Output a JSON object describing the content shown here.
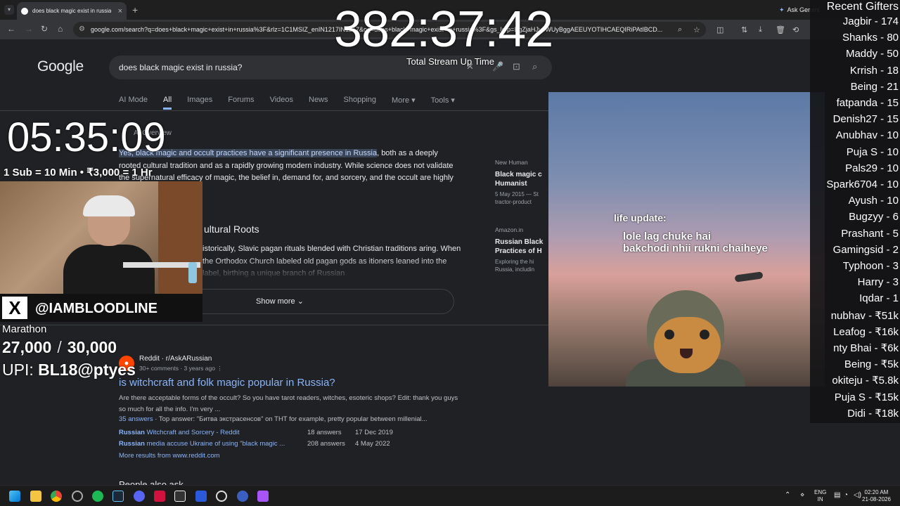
{
  "browser": {
    "tab_title": "does black magic exist in russia",
    "url": "google.com/search?q=does+black+magic+exist+in+russia%3F&rlz=1C1MSIZ_enIN1217IN1217&oq=does+black+magic+exist+in+russia%3F&gs_lcrp=EgZjaHJvbWUyBggAEEUYOTIHCAEQIRiPAtIBCD...",
    "ask_gemini": "Ask Gemini"
  },
  "google": {
    "logo": "Google",
    "query": "does black magic exist in russia?",
    "tabs": [
      "AI Mode",
      "All",
      "Images",
      "Forums",
      "Videos",
      "News",
      "Shopping",
      "More",
      "Tools"
    ],
    "ai_overview_label": "AI Overview",
    "ai_text_highlight": "Yes, black magic and occult practices have a significant presence in Russia",
    "ai_text_rest": ", both as a deeply rooted cultural tradition and as a rapidly growing modern industry. While science does not validate the supernatural efficacy of magic, the belief in, demand for, and sorcery, and the occult are highly prevalent across the",
    "section_heading": "ultural Roots",
    "history_text": "istorically, Slavic pagan rituals blended with Christian traditions aring. When the Orthodox Church labeled old pagan gods as itioners leaned into the label, birthing a unique branch of Russian",
    "show_more": "Show more",
    "source_cards": [
      {
        "site": "New Human",
        "title": "Black magic c Humanist",
        "sub": "5 May 2015 — St tractor-product"
      },
      {
        "site": "Amazon.in",
        "title": "Russian Black Practices of H",
        "sub": "Exploring the hi Russia, includin"
      }
    ],
    "reddit": {
      "source": "Reddit · r/AskARussian",
      "meta": "30+ comments · 3 years ago",
      "title": "is witchcraft and folk magic popular in Russia?",
      "snippet": "Are there acceptable forms of the occult? So you have tarot readers, witches, esoteric shops? Edit: thank you guys so much for all the info. I'm very ...",
      "answers_count": "35 answers",
      "top_answer": " · Top answer: \"Битва экстрасенсов\" on THT for example, pretty popular between millenial...",
      "related": [
        {
          "title_bold": "Russian",
          "title_rest": " Witchcraft and Sorcery - Reddit",
          "answers": "18 answers",
          "date": "17 Dec 2019"
        },
        {
          "title_bold": "Russian",
          "title_rest": " media accuse Ukraine of using \"black magic ...",
          "answers": "208 answers",
          "date": "4 May 2022"
        }
      ],
      "more_results": "More results from www.reddit.com"
    },
    "paa": "People also ask"
  },
  "overlay": {
    "stream_timer": "382:37:42",
    "stream_label": "Total Stream Up Time",
    "sub_timer": "05:35:09",
    "sub_rule": "1 Sub = 10 Min  •  ₹3,000 = 1 Hr",
    "handle": "@IAMBLOODLINE",
    "x_logo": "X",
    "marathon": "Marathon",
    "goal_current": "27,000",
    "goal_sep": "/",
    "goal_target": "30,000",
    "upi_label": "UPI: ",
    "upi_id": "BL18@ptyes"
  },
  "meme": {
    "line1": "life update:",
    "line2": "lole lag chuke hai",
    "line3": "bakchodi nhii rukni chaiheye"
  },
  "gifters": {
    "title": "Recent Gifters",
    "items": [
      "Jagbir - 174",
      "Shanks - 80",
      "Maddy - 50",
      "Krrish - 18",
      "Being - 21",
      "fatpanda - 15",
      "Denish27 - 15",
      "Anubhav - 10",
      "Puja S - 10",
      "Pals29 - 10",
      "Spark6704 - 10",
      "Ayush - 10",
      "Bugzyy - 6",
      "Prashant - 5",
      "Gamingsid - 2",
      "Typhoon - 3",
      "Harry - 3",
      "Iqdar - 1",
      "nubhav - ₹51k",
      "Leafog - ₹16k",
      "nty Bhai - ₹6k",
      "Being - ₹5k",
      "okiteju - ₹5.8k",
      "Puja S - ₹15k",
      "Didi - ₹18k"
    ]
  },
  "taskbar": {
    "lang1": "ENG",
    "lang2": "IN",
    "time": "02:20 AM",
    "date": "21-08-2026"
  },
  "colors": {
    "link": "#8ab4f8",
    "highlight_bg": "#394457",
    "reddit": "#ff4500"
  }
}
